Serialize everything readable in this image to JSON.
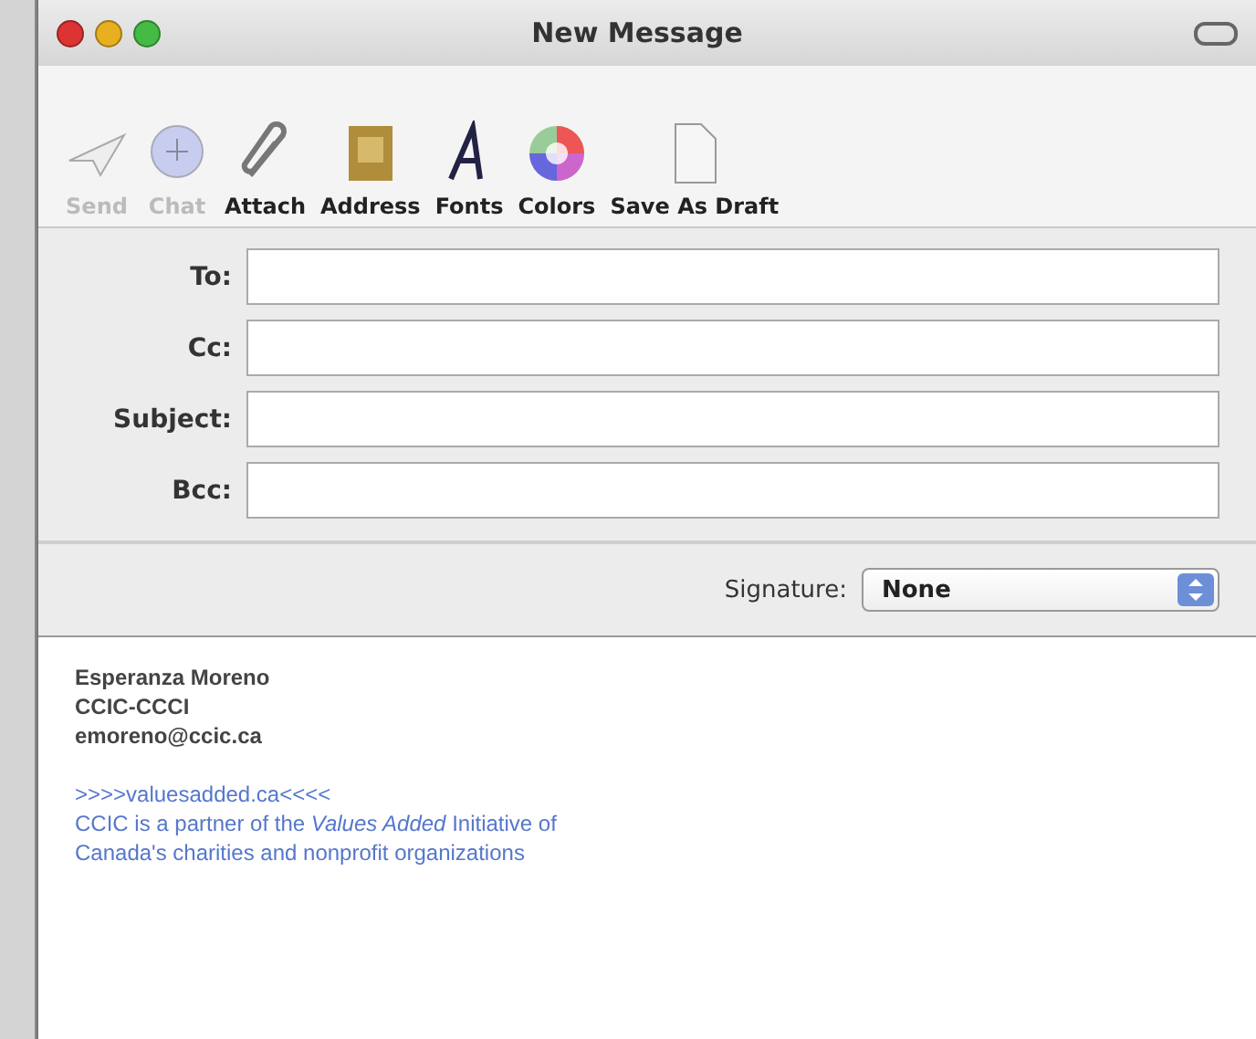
{
  "window": {
    "title": "New Message"
  },
  "toolbar": [
    {
      "kind": "send",
      "label": "Send",
      "disabled": true
    },
    {
      "kind": "chat",
      "label": "Chat",
      "disabled": true
    },
    {
      "kind": "attach",
      "label": "Attach",
      "disabled": false
    },
    {
      "kind": "address",
      "label": "Address",
      "disabled": false
    },
    {
      "kind": "fonts",
      "label": "Fonts",
      "disabled": false
    },
    {
      "kind": "colors",
      "label": "Colors",
      "disabled": false
    },
    {
      "kind": "draft",
      "label": "Save As Draft",
      "disabled": false
    }
  ],
  "fields": [
    {
      "label": "To:"
    },
    {
      "label": "Cc:"
    },
    {
      "label": "Subject:"
    },
    {
      "label": "Bcc:"
    }
  ],
  "signature": {
    "label": "Signature:",
    "value": "None"
  },
  "body": {
    "lines": [
      {
        "kind": "bold",
        "text": "Esperanza Moreno"
      },
      {
        "kind": "bold",
        "text": "CCIC-CCCI"
      },
      {
        "kind": "bold",
        "text": "emoreno@ccic.ca"
      },
      {
        "kind": "gap"
      },
      {
        "kind": "link",
        "text": ">>>>valuesadded.ca<<<<"
      },
      {
        "kind": "link",
        "text": "CCIC is a partner of the *Values Added* Initiative of"
      },
      {
        "kind": "link",
        "text": "Canada's charities and nonprofit organizations"
      }
    ]
  }
}
